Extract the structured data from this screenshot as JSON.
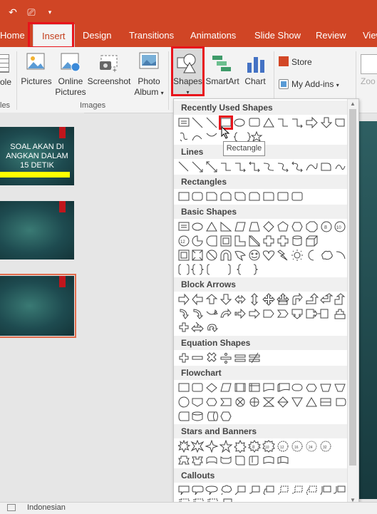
{
  "tabs": [
    "Home",
    "Insert",
    "Design",
    "Transitions",
    "Animations",
    "Slide Show",
    "Review",
    "View"
  ],
  "ribbon": {
    "buttons": {
      "table_partial": "ole",
      "pictures": "Pictures",
      "online_pictures_1": "Online",
      "online_pictures_2": "Pictures",
      "screenshot": "Screenshot",
      "photo_album_1": "Photo",
      "photo_album_2": "Album",
      "shapes": "Shapes",
      "smartart": "SmartArt",
      "chart": "Chart",
      "store": "Store",
      "my_addins": "My Add-ins",
      "zoom_partial": "Zoo"
    },
    "groups": {
      "tables_partial": "les",
      "images": "Images"
    }
  },
  "slides": {
    "slide1_lines": [
      "SOAL AKAN DI",
      "ANGKAN DALAM",
      "15 DETIK"
    ]
  },
  "shapes_panel": {
    "categories": {
      "recent": "Recently Used Shapes",
      "lines": "Lines",
      "rectangles": "Rectangles",
      "basic": "Basic Shapes",
      "block_arrows": "Block Arrows",
      "equation": "Equation Shapes",
      "flowchart": "Flowchart",
      "stars": "Stars and Banners",
      "callouts": "Callouts"
    },
    "tooltip": "Rectangle"
  },
  "status": {
    "language": "Indonesian"
  },
  "colors": {
    "accent": "#d04525",
    "highlight": "#e8141b"
  }
}
